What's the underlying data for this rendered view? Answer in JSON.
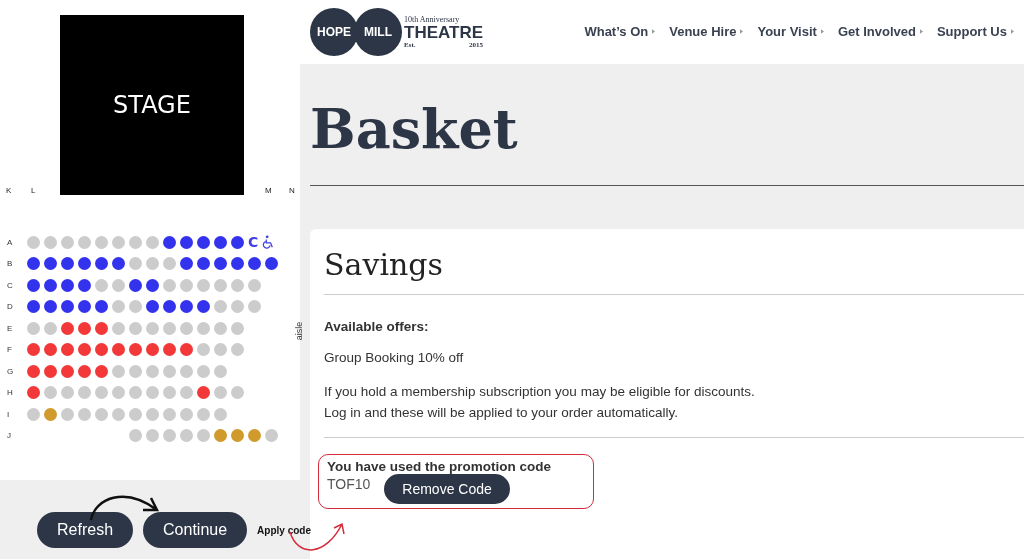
{
  "seat_map": {
    "stage": "STAGE",
    "side_labels": [
      "K",
      "L",
      "M",
      "N"
    ],
    "aisle": "aisle",
    "rows": [
      {
        "label": "A",
        "end_mark": "C",
        "wheelchair": true,
        "seats": [
          {
            "kind": "seat",
            "color": "#cccccc"
          },
          {
            "kind": "seat",
            "color": "#cccccc"
          },
          {
            "kind": "seat",
            "color": "#cccccc"
          },
          {
            "kind": "seat",
            "color": "#cccccc"
          },
          {
            "kind": "seat",
            "color": "#cccccc"
          },
          {
            "kind": "seat",
            "color": "#cccccc"
          },
          {
            "kind": "seat",
            "color": "#cccccc"
          },
          {
            "kind": "seat",
            "color": "#cccccc"
          },
          {
            "kind": "seat",
            "color": "#3333ee"
          },
          {
            "kind": "seat",
            "color": "#3333ee"
          },
          {
            "kind": "seat",
            "color": "#3333ee"
          },
          {
            "kind": "seat",
            "color": "#3333ee"
          },
          {
            "kind": "seat",
            "color": "#3333ee"
          }
        ]
      },
      {
        "label": "B",
        "seats": [
          {
            "kind": "seat",
            "color": "#3333ee"
          },
          {
            "kind": "seat",
            "color": "#3333ee"
          },
          {
            "kind": "seat",
            "color": "#3333ee"
          },
          {
            "kind": "seat",
            "color": "#3333ee"
          },
          {
            "kind": "seat",
            "color": "#3333ee"
          },
          {
            "kind": "seat",
            "color": "#3333ee"
          },
          {
            "kind": "seat",
            "color": "#cccccc"
          },
          {
            "kind": "seat",
            "color": "#cccccc"
          },
          {
            "kind": "seat",
            "color": "#cccccc"
          },
          {
            "kind": "seat",
            "color": "#3333ee"
          },
          {
            "kind": "seat",
            "color": "#3333ee"
          },
          {
            "kind": "seat",
            "color": "#3333ee"
          },
          {
            "kind": "seat",
            "color": "#3333ee"
          },
          {
            "kind": "seat",
            "color": "#3333ee"
          },
          {
            "kind": "seat",
            "color": "#3333ee"
          }
        ]
      },
      {
        "label": "C",
        "seats": [
          {
            "kind": "seat",
            "color": "#3333ee"
          },
          {
            "kind": "seat",
            "color": "#3333ee"
          },
          {
            "kind": "seat",
            "color": "#3333ee"
          },
          {
            "kind": "seat",
            "color": "#3333ee"
          },
          {
            "kind": "seat",
            "color": "#cccccc"
          },
          {
            "kind": "seat",
            "color": "#cccccc"
          },
          {
            "kind": "seat",
            "color": "#3333ee"
          },
          {
            "kind": "seat",
            "color": "#3333ee"
          },
          {
            "kind": "seat",
            "color": "#cccccc"
          },
          {
            "kind": "seat",
            "color": "#cccccc"
          },
          {
            "kind": "seat",
            "color": "#cccccc"
          },
          {
            "kind": "seat",
            "color": "#cccccc"
          },
          {
            "kind": "seat",
            "color": "#cccccc"
          },
          {
            "kind": "seat",
            "color": "#cccccc"
          }
        ]
      },
      {
        "label": "D",
        "seats": [
          {
            "kind": "seat",
            "color": "#3333ee"
          },
          {
            "kind": "seat",
            "color": "#3333ee"
          },
          {
            "kind": "seat",
            "color": "#3333ee"
          },
          {
            "kind": "seat",
            "color": "#3333ee"
          },
          {
            "kind": "seat",
            "color": "#3333ee"
          },
          {
            "kind": "seat",
            "color": "#cccccc"
          },
          {
            "kind": "seat",
            "color": "#cccccc"
          },
          {
            "kind": "seat",
            "color": "#3333ee"
          },
          {
            "kind": "seat",
            "color": "#3333ee"
          },
          {
            "kind": "seat",
            "color": "#3333ee"
          },
          {
            "kind": "seat",
            "color": "#3333ee"
          },
          {
            "kind": "seat",
            "color": "#cccccc"
          },
          {
            "kind": "seat",
            "color": "#cccccc"
          },
          {
            "kind": "seat",
            "color": "#cccccc"
          }
        ]
      },
      {
        "label": "E",
        "seats": [
          {
            "kind": "seat",
            "color": "#cccccc"
          },
          {
            "kind": "seat",
            "color": "#cccccc"
          },
          {
            "kind": "seat",
            "color": "#f23838"
          },
          {
            "kind": "seat",
            "color": "#f23838"
          },
          {
            "kind": "seat",
            "color": "#f23838"
          },
          {
            "kind": "seat",
            "color": "#cccccc"
          },
          {
            "kind": "seat",
            "color": "#cccccc"
          },
          {
            "kind": "seat",
            "color": "#cccccc"
          },
          {
            "kind": "seat",
            "color": "#cccccc"
          },
          {
            "kind": "seat",
            "color": "#cccccc"
          },
          {
            "kind": "seat",
            "color": "#cccccc"
          },
          {
            "kind": "seat",
            "color": "#cccccc"
          },
          {
            "kind": "seat",
            "color": "#cccccc"
          }
        ]
      },
      {
        "label": "F",
        "seats": [
          {
            "kind": "seat",
            "color": "#f23838"
          },
          {
            "kind": "seat",
            "color": "#f23838"
          },
          {
            "kind": "seat",
            "color": "#f23838"
          },
          {
            "kind": "seat",
            "color": "#f23838"
          },
          {
            "kind": "seat",
            "color": "#f23838"
          },
          {
            "kind": "seat",
            "color": "#f23838"
          },
          {
            "kind": "seat",
            "color": "#f23838"
          },
          {
            "kind": "seat",
            "color": "#f23838"
          },
          {
            "kind": "seat",
            "color": "#f23838"
          },
          {
            "kind": "seat",
            "color": "#f23838"
          },
          {
            "kind": "seat",
            "color": "#cccccc"
          },
          {
            "kind": "seat",
            "color": "#cccccc"
          },
          {
            "kind": "seat",
            "color": "#cccccc"
          }
        ]
      },
      {
        "label": "G",
        "seats": [
          {
            "kind": "seat",
            "color": "#f23838"
          },
          {
            "kind": "seat",
            "color": "#f23838"
          },
          {
            "kind": "seat",
            "color": "#f23838"
          },
          {
            "kind": "seat",
            "color": "#f23838"
          },
          {
            "kind": "seat",
            "color": "#f23838"
          },
          {
            "kind": "seat",
            "color": "#cccccc"
          },
          {
            "kind": "seat",
            "color": "#cccccc"
          },
          {
            "kind": "seat",
            "color": "#cccccc"
          },
          {
            "kind": "seat",
            "color": "#cccccc"
          },
          {
            "kind": "seat",
            "color": "#cccccc"
          },
          {
            "kind": "seat",
            "color": "#cccccc"
          },
          {
            "kind": "seat",
            "color": "#cccccc"
          }
        ]
      },
      {
        "label": "H",
        "seats": [
          {
            "kind": "seat",
            "color": "#f23838"
          },
          {
            "kind": "seat",
            "color": "#cccccc"
          },
          {
            "kind": "seat",
            "color": "#cccccc"
          },
          {
            "kind": "seat",
            "color": "#cccccc"
          },
          {
            "kind": "seat",
            "color": "#cccccc"
          },
          {
            "kind": "seat",
            "color": "#cccccc"
          },
          {
            "kind": "seat",
            "color": "#cccccc"
          },
          {
            "kind": "seat",
            "color": "#cccccc"
          },
          {
            "kind": "seat",
            "color": "#cccccc"
          },
          {
            "kind": "seat",
            "color": "#cccccc"
          },
          {
            "kind": "seat",
            "color": "#f23838"
          },
          {
            "kind": "seat",
            "color": "#cccccc"
          },
          {
            "kind": "seat",
            "color": "#cccccc"
          }
        ]
      },
      {
        "label": "I",
        "seats": [
          {
            "kind": "seat",
            "color": "#cccccc"
          },
          {
            "kind": "seat",
            "color": "#d09a2c"
          },
          {
            "kind": "seat",
            "color": "#cccccc"
          },
          {
            "kind": "seat",
            "color": "#cccccc"
          },
          {
            "kind": "seat",
            "color": "#cccccc"
          },
          {
            "kind": "seat",
            "color": "#cccccc"
          },
          {
            "kind": "seat",
            "color": "#cccccc"
          },
          {
            "kind": "seat",
            "color": "#cccccc"
          },
          {
            "kind": "seat",
            "color": "#cccccc"
          },
          {
            "kind": "seat",
            "color": "#cccccc"
          },
          {
            "kind": "seat",
            "color": "#cccccc"
          },
          {
            "kind": "seat",
            "color": "#cccccc"
          }
        ]
      },
      {
        "label": "J",
        "seats": [
          {
            "kind": "gap"
          },
          {
            "kind": "gap"
          },
          {
            "kind": "gap"
          },
          {
            "kind": "gap"
          },
          {
            "kind": "gap"
          },
          {
            "kind": "gap"
          },
          {
            "kind": "seat",
            "color": "#cccccc"
          },
          {
            "kind": "seat",
            "color": "#cccccc"
          },
          {
            "kind": "seat",
            "color": "#cccccc"
          },
          {
            "kind": "seat",
            "color": "#cccccc"
          },
          {
            "kind": "seat",
            "color": "#cccccc"
          },
          {
            "kind": "seat",
            "color": "#d09a2c"
          },
          {
            "kind": "seat",
            "color": "#d09a2c"
          },
          {
            "kind": "seat",
            "color": "#d09a2c"
          },
          {
            "kind": "seat",
            "color": "#cccccc"
          }
        ]
      }
    ]
  },
  "buttons": [
    "Refresh",
    "Continue"
  ],
  "annotation": "Apply code",
  "header": {
    "logo": {
      "left": "HOPE",
      "right": "MILL",
      "anniversary": "10th Anniversary",
      "name": "THEATRE",
      "est": "Est.",
      "year": "2015"
    },
    "nav": [
      "What’s On",
      "Venue Hire",
      "Your Visit",
      "Get Involved",
      "Support Us"
    ]
  },
  "page_title": "Basket",
  "savings": {
    "title": "Savings",
    "offers_heading": "Available offers:",
    "offer": "Group Booking 10% off",
    "membership": [
      "If you hold a membership subscription you may be eligible for discounts.",
      "Log in and these will be applied to your order automatically."
    ],
    "promo": {
      "message": "You have used the promotion code",
      "code": "TOF10",
      "button": "Remove Code"
    }
  }
}
